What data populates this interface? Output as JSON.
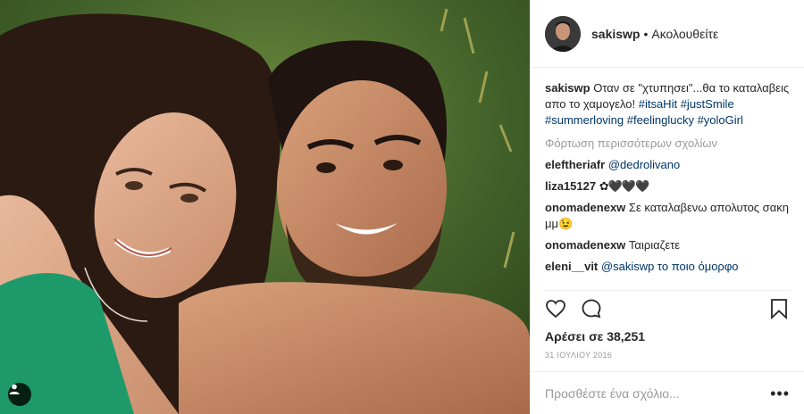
{
  "header": {
    "username": "sakiswp",
    "separator": "•",
    "follow_status": "Ακολουθείτε"
  },
  "caption": {
    "username": "sakiswp",
    "text": "Οταν σε \"χτυπησει\"...θα το καταλαβεις απο το χαμογελο!",
    "hashtags": [
      "#itsaHit",
      "#justSmile",
      "#summerloving",
      "#feelinglucky",
      "#yoloGirl"
    ]
  },
  "load_more": "Φόρτωση περισσότερων σχολίων",
  "comments": [
    {
      "username": "eleftheriafr",
      "text": "@dedrolivano"
    },
    {
      "username": "liza15127",
      "text": "✿🖤🖤🖤"
    },
    {
      "username": "onomadenexw",
      "text": "Σε καταλαβενω απολυτος σακη μμ😉"
    },
    {
      "username": "onomadenexw",
      "text": "Ταιριαζετε"
    },
    {
      "username": "eleni__vit",
      "text": "@sakiswp το ποιο όμορφο"
    }
  ],
  "likes": "Αρέσει σε 38,251",
  "date": "31 ΙΟΥΛΙΟΥ 2016",
  "add_comment": {
    "placeholder": "Προσθέστε ένα σχόλιο..."
  },
  "more_options": "•••",
  "icons": [
    "heart-icon",
    "comment-icon",
    "bookmark-icon",
    "user-tag-icon",
    "more-options-icon"
  ]
}
